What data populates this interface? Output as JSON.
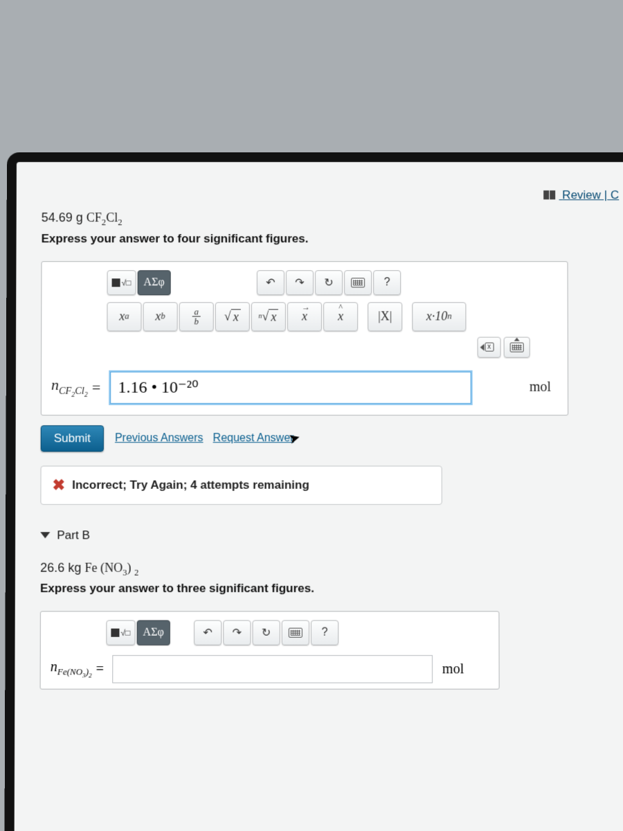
{
  "header": {
    "review_link": "Review | C"
  },
  "partA": {
    "mass": "54.69 g ",
    "compound_html": "CF₂Cl₂",
    "instruction": "Express your answer to four significant figures.",
    "var_label_html": "nCF₂Cl₂",
    "equals": "=",
    "input_value": "1.16 • 10⁻²⁰",
    "unit": "mol",
    "submit": "Submit",
    "prev_link": "Previous Answers",
    "req_link": "Request Answer",
    "feedback": "Incorrect; Try Again; 4 attempts remaining"
  },
  "toolbar": {
    "templates": "ΑΣφ",
    "help": "?",
    "xa": "xᵃ",
    "xb": "xᵦ",
    "vec": "x⃗",
    "hat": "x̂",
    "abs": "|x|",
    "sci": "x·10ⁿ"
  },
  "partB": {
    "title": "Part B",
    "mass": "26.6 kg ",
    "compound_html": "Fe (NO₃) ₂",
    "instruction": "Express your answer to three significant figures.",
    "var_label_html": "nFe(NO₃)₂",
    "equals": "=",
    "unit": "mol"
  }
}
